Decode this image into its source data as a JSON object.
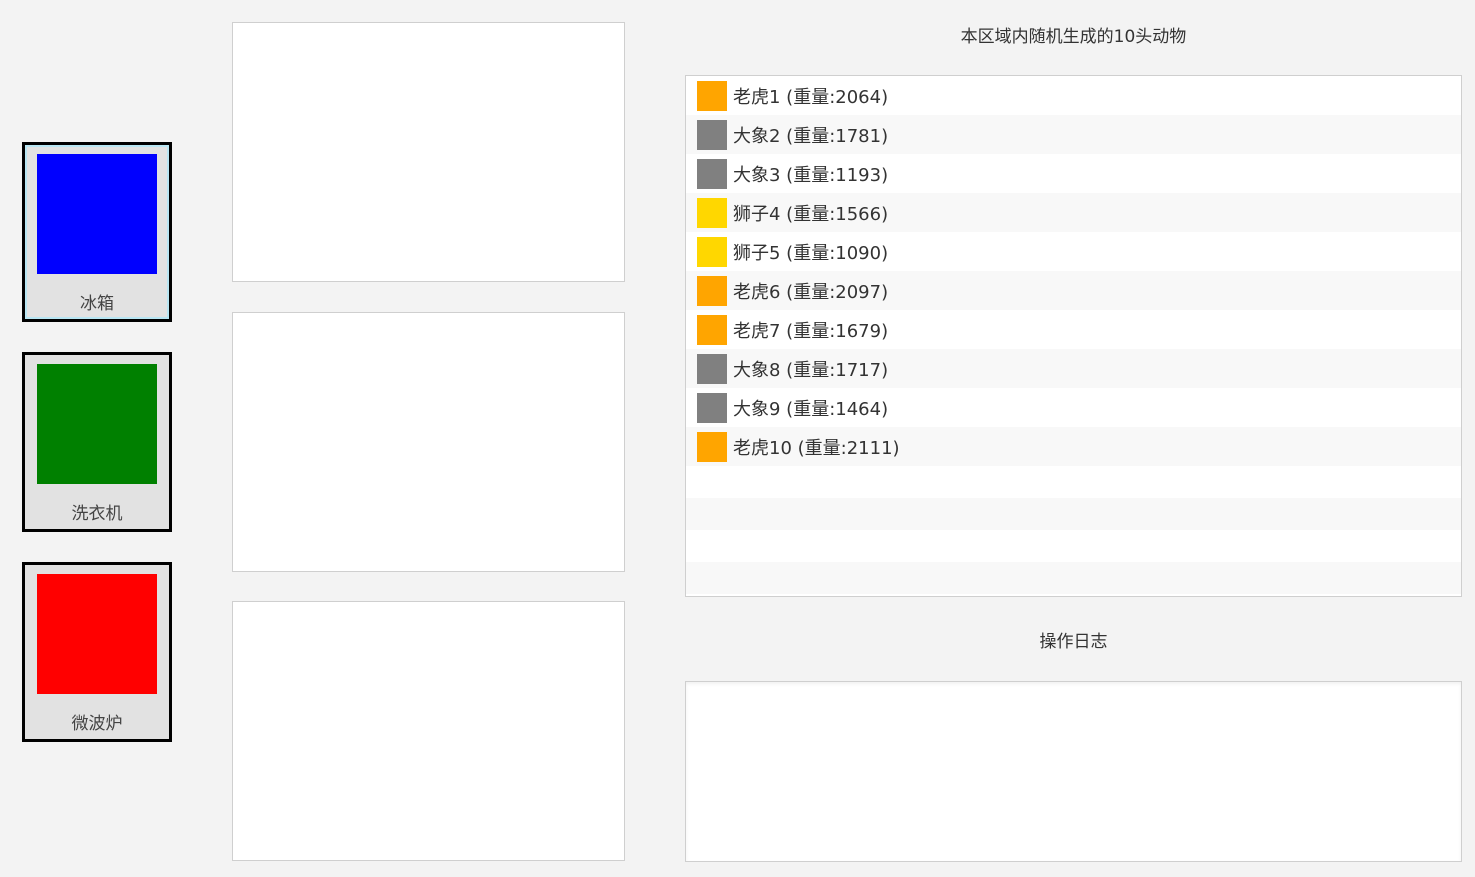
{
  "colors": {
    "background": "#f3f3f3",
    "tiger": "#ffa500",
    "elephant": "#808080",
    "lion": "#ffd700"
  },
  "appliances": [
    {
      "label": "冰箱",
      "color": "#0000ff"
    },
    {
      "label": "洗衣机",
      "color": "#008000"
    },
    {
      "label": "微波炉",
      "color": "#ff0000"
    }
  ],
  "animals_title": "本区域内随机生成的10头动物",
  "animals": [
    {
      "label": "老虎1 (重量:2064)",
      "color": "#ffa500"
    },
    {
      "label": "大象2 (重量:1781)",
      "color": "#808080"
    },
    {
      "label": "大象3 (重量:1193)",
      "color": "#808080"
    },
    {
      "label": "狮子4 (重量:1566)",
      "color": "#ffd700"
    },
    {
      "label": "狮子5 (重量:1090)",
      "color": "#ffd700"
    },
    {
      "label": "老虎6 (重量:2097)",
      "color": "#ffa500"
    },
    {
      "label": "老虎7 (重量:1679)",
      "color": "#ffa500"
    },
    {
      "label": "大象8 (重量:1717)",
      "color": "#808080"
    },
    {
      "label": "大象9 (重量:1464)",
      "color": "#808080"
    },
    {
      "label": "老虎10 (重量:2111)",
      "color": "#ffa500"
    }
  ],
  "log_title": "操作日志"
}
